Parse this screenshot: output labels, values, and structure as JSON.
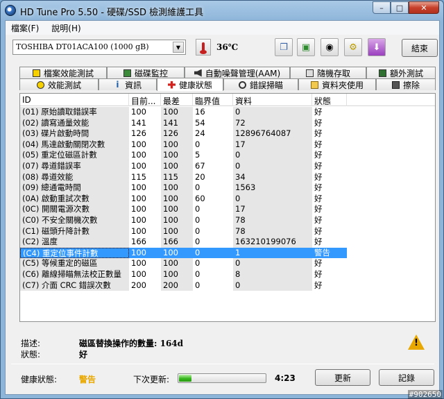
{
  "window": {
    "title": "HD Tune Pro 5.50 - 硬碟/SSD 檢測維護工具"
  },
  "menu": [
    "檔案(F)",
    "說明(H)"
  ],
  "toolbar": {
    "drive": "TOSHIBA DT01ACA100 (1000 gB)",
    "temperature": "36℃",
    "exit_label": "結束",
    "icons": [
      "copy-icon",
      "save-icon",
      "camera-icon",
      "options-icon",
      "download-icon"
    ]
  },
  "tabs": [
    {
      "label": "檔案效能測試",
      "icon": "file-benchmark-icon",
      "row": 0
    },
    {
      "label": "磁碟監控",
      "icon": "disk-monitor-icon",
      "row": 0
    },
    {
      "label": "自動噪聲管理(AAM)",
      "icon": "speaker-icon",
      "row": 0
    },
    {
      "label": "隨機存取",
      "icon": "random-access-icon",
      "row": 0
    },
    {
      "label": "額外測試",
      "icon": "extra-tests-icon",
      "row": 0
    },
    {
      "label": "效能測試",
      "icon": "benchmark-icon",
      "row": 1
    },
    {
      "label": "資訊",
      "icon": "info-icon",
      "row": 1
    },
    {
      "label": "健康狀態",
      "icon": "health-cross-icon",
      "row": 1,
      "active": true
    },
    {
      "label": "錯誤掃瞄",
      "icon": "error-scan-icon",
      "row": 1
    },
    {
      "label": "資料夾使用",
      "icon": "folder-icon",
      "row": 1
    },
    {
      "label": "擦除",
      "icon": "erase-icon",
      "row": 1
    }
  ],
  "table": {
    "columns": [
      "ID",
      "目前...",
      "最差",
      "臨界值",
      "資料",
      "狀態"
    ],
    "rows": [
      [
        "(01) 原始讀取錯誤率",
        "100",
        "100",
        "16",
        "0",
        "好"
      ],
      [
        "(02) 讀寫通量效能",
        "141",
        "141",
        "54",
        "72",
        "好"
      ],
      [
        "(03) 碟片啟動時間",
        "126",
        "126",
        "24",
        "12896764087",
        "好"
      ],
      [
        "(04) 馬達啟動關閉次數",
        "100",
        "100",
        "0",
        "17",
        "好"
      ],
      [
        "(05) 重定位磁區計數",
        "100",
        "100",
        "5",
        "0",
        "好"
      ],
      [
        "(07) 尋道錯誤率",
        "100",
        "100",
        "67",
        "0",
        "好"
      ],
      [
        "(08) 尋道效能",
        "115",
        "115",
        "20",
        "34",
        "好"
      ],
      [
        "(09) 總通電時間",
        "100",
        "100",
        "0",
        "1563",
        "好"
      ],
      [
        "(0A) 啟動重試次數",
        "100",
        "100",
        "60",
        "0",
        "好"
      ],
      [
        "(0C) 開關電源次數",
        "100",
        "100",
        "0",
        "17",
        "好"
      ],
      [
        "(C0) 不安全關機次數",
        "100",
        "100",
        "0",
        "78",
        "好"
      ],
      [
        "(C1) 磁頭升降計數",
        "100",
        "100",
        "0",
        "78",
        "好"
      ],
      [
        "(C2) 溫度",
        "166",
        "166",
        "0",
        "163210199076",
        "好"
      ],
      [
        "(C4) 重定位事件計數",
        "100",
        "100",
        "0",
        "1",
        "警告"
      ],
      [
        "(C5) 等候重定的磁區",
        "100",
        "100",
        "0",
        "0",
        "好"
      ],
      [
        "(C6) 離線掃瞄無法校正數量",
        "100",
        "100",
        "0",
        "8",
        "好"
      ],
      [
        "(C7) 介面 CRC 錯誤次數",
        "200",
        "200",
        "0",
        "0",
        "好"
      ]
    ],
    "highlight_row": 13
  },
  "description": {
    "desc_label": "描述:",
    "desc_value": "磁區替換操作的數量: 164d",
    "status_label": "狀態:",
    "status_value": "好"
  },
  "footer": {
    "health_label": "健康狀態:",
    "health_value": "警告",
    "next_update_label": "下次更新:",
    "progress_percent": 14,
    "countdown": "4:23",
    "refresh_label": "更新",
    "log_label": "記錄"
  },
  "watermark": "#902650",
  "colors": {
    "warning": "#e8a800",
    "selection": "#3399ff",
    "progress": "#37b61d"
  }
}
